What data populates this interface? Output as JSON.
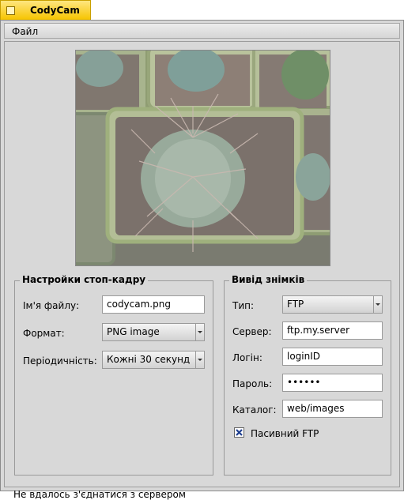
{
  "window": {
    "title": "CodyCam"
  },
  "menu": {
    "items": [
      "Файл"
    ]
  },
  "snapshot_settings": {
    "title": "Настройки стоп-кадру",
    "filename_label": "Ім'я файлу:",
    "filename_value": "codycam.png",
    "format_label": "Формат:",
    "format_value": "PNG image",
    "interval_label": "Періодичність:",
    "interval_value": "Кожні 30 секунд"
  },
  "output": {
    "title": "Вивід знімків",
    "type_label": "Тип:",
    "type_value": "FTP",
    "server_label": "Сервер:",
    "server_value": "ftp.my.server",
    "login_label": "Логін:",
    "login_value": "loginID",
    "password_label": "Пароль:",
    "password_value": "••••••",
    "directory_label": "Каталог:",
    "directory_value": "web/images",
    "passive_label": "Пасивний FTP",
    "passive_checked": true
  },
  "status": {
    "text": "Не вдалось з'єднатися з сервером"
  }
}
